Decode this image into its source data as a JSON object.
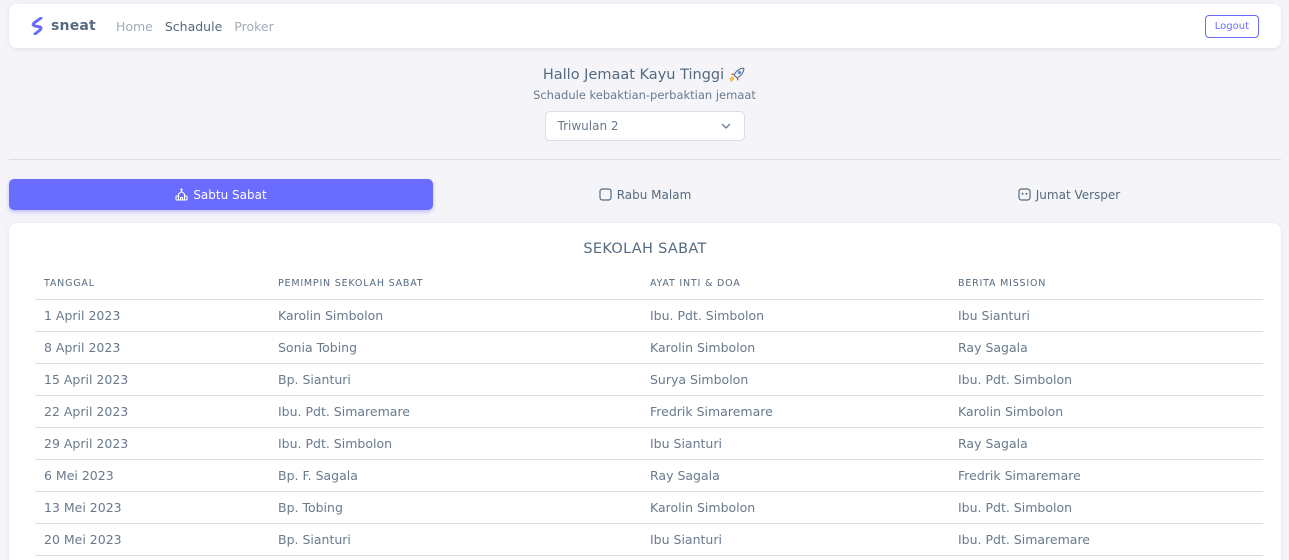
{
  "navbar": {
    "brand": "sneat",
    "links": [
      "Home",
      "Schadule",
      "Proker"
    ],
    "logout": "Logout",
    "accent": "#696cff"
  },
  "hero": {
    "title": "Hallo Jemaat Kayu Tinggi",
    "title_icon": "rocket-icon",
    "subtitle": "Schadule kebaktian-perbaktian jemaat",
    "select_value": "Triwulan 2"
  },
  "tabs": [
    {
      "label": "Sabtu Sabat",
      "icon": "church-icon",
      "active": true
    },
    {
      "label": "Rabu Malam",
      "icon": "square-icon",
      "active": false
    },
    {
      "label": "Jumat Versper",
      "icon": "ghost-icon",
      "active": false
    }
  ],
  "table": {
    "title": "SEKOLAH SABAT",
    "headers": [
      "TANGGAL",
      "PEMIMPIN SEKOLAH SABAT",
      "AYAT INTI & DOA",
      "BERITA MISSION"
    ],
    "rows": [
      [
        "1 April 2023",
        "Karolin Simbolon",
        "Ibu. Pdt. Simbolon",
        "Ibu Sianturi"
      ],
      [
        "8 April 2023",
        "Sonia Tobing",
        "Karolin Simbolon",
        "Ray Sagala"
      ],
      [
        "15 April 2023",
        "Bp. Sianturi",
        "Surya Simbolon",
        "Ibu. Pdt. Simbolon"
      ],
      [
        "22 April 2023",
        "Ibu. Pdt. Simaremare",
        "Fredrik Simaremare",
        "Karolin Simbolon"
      ],
      [
        "29 April 2023",
        "Ibu. Pdt. Simbolon",
        "Ibu Sianturi",
        "Ray Sagala"
      ],
      [
        "6 Mei 2023",
        "Bp. F. Sagala",
        "Ray Sagala",
        "Fredrik Simaremare"
      ],
      [
        "13 Mei 2023",
        "Bp. Tobing",
        "Karolin Simbolon",
        "Ibu. Pdt. Simbolon"
      ],
      [
        "20 Mei 2023",
        "Bp. Sianturi",
        "Ibu Sianturi",
        "Ibu. Pdt. Simaremare"
      ]
    ]
  }
}
